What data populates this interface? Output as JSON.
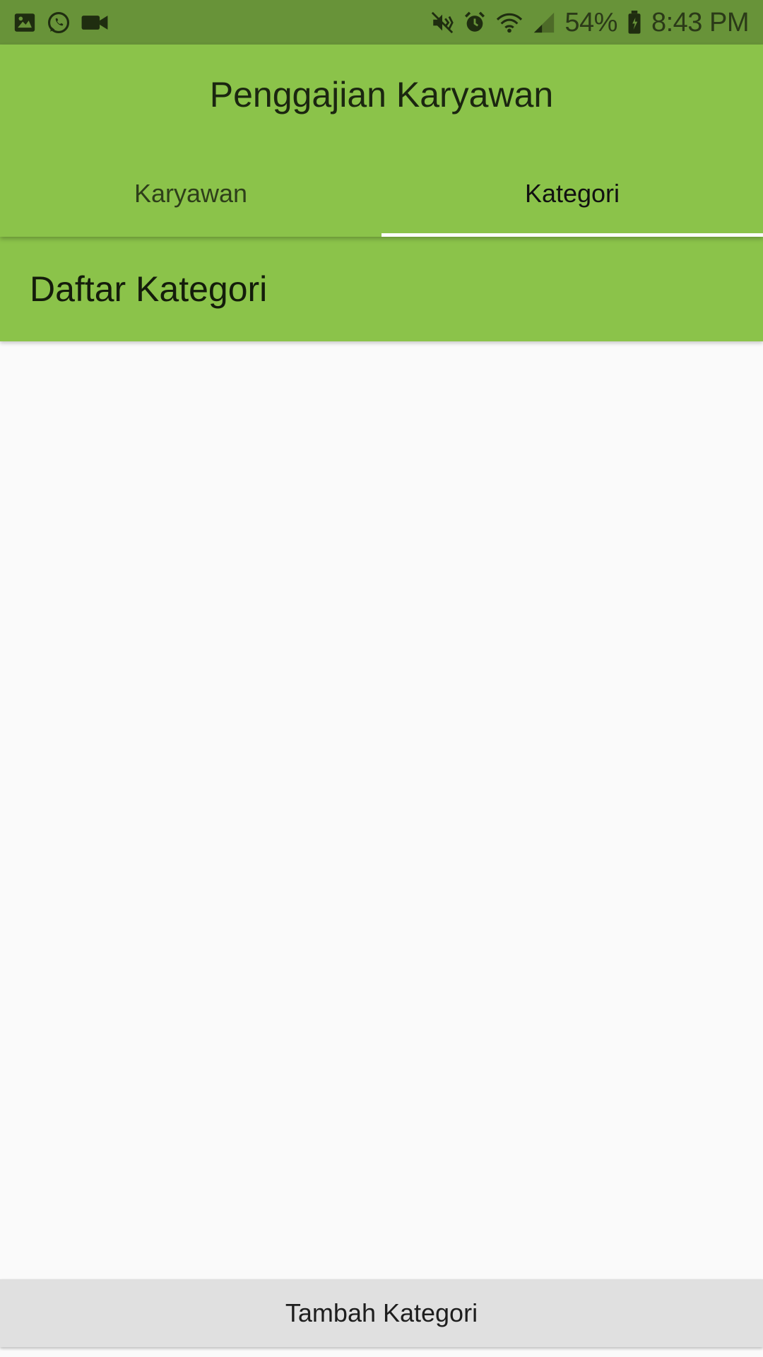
{
  "status_bar": {
    "left_icons": [
      "gallery-icon",
      "whatsapp-icon",
      "video-camera-icon"
    ],
    "right_icons": [
      "mute-vibrate-icon",
      "alarm-icon",
      "wifi-icon",
      "signal-icon"
    ],
    "battery_percent": "54%",
    "time": "8:43 PM"
  },
  "app_bar": {
    "title": "Penggajian Karyawan",
    "tabs": [
      {
        "label": "Karyawan",
        "active": false
      },
      {
        "label": "Kategori",
        "active": true
      }
    ]
  },
  "section": {
    "title": "Daftar Kategori"
  },
  "actions": {
    "add_label": "Tambah Kategori"
  },
  "colors": {
    "primary": "#8bc34a",
    "status_bar": "#689339",
    "tab_indicator": "#ffffff",
    "background": "#fafafa",
    "button": "#e0e0e0"
  }
}
